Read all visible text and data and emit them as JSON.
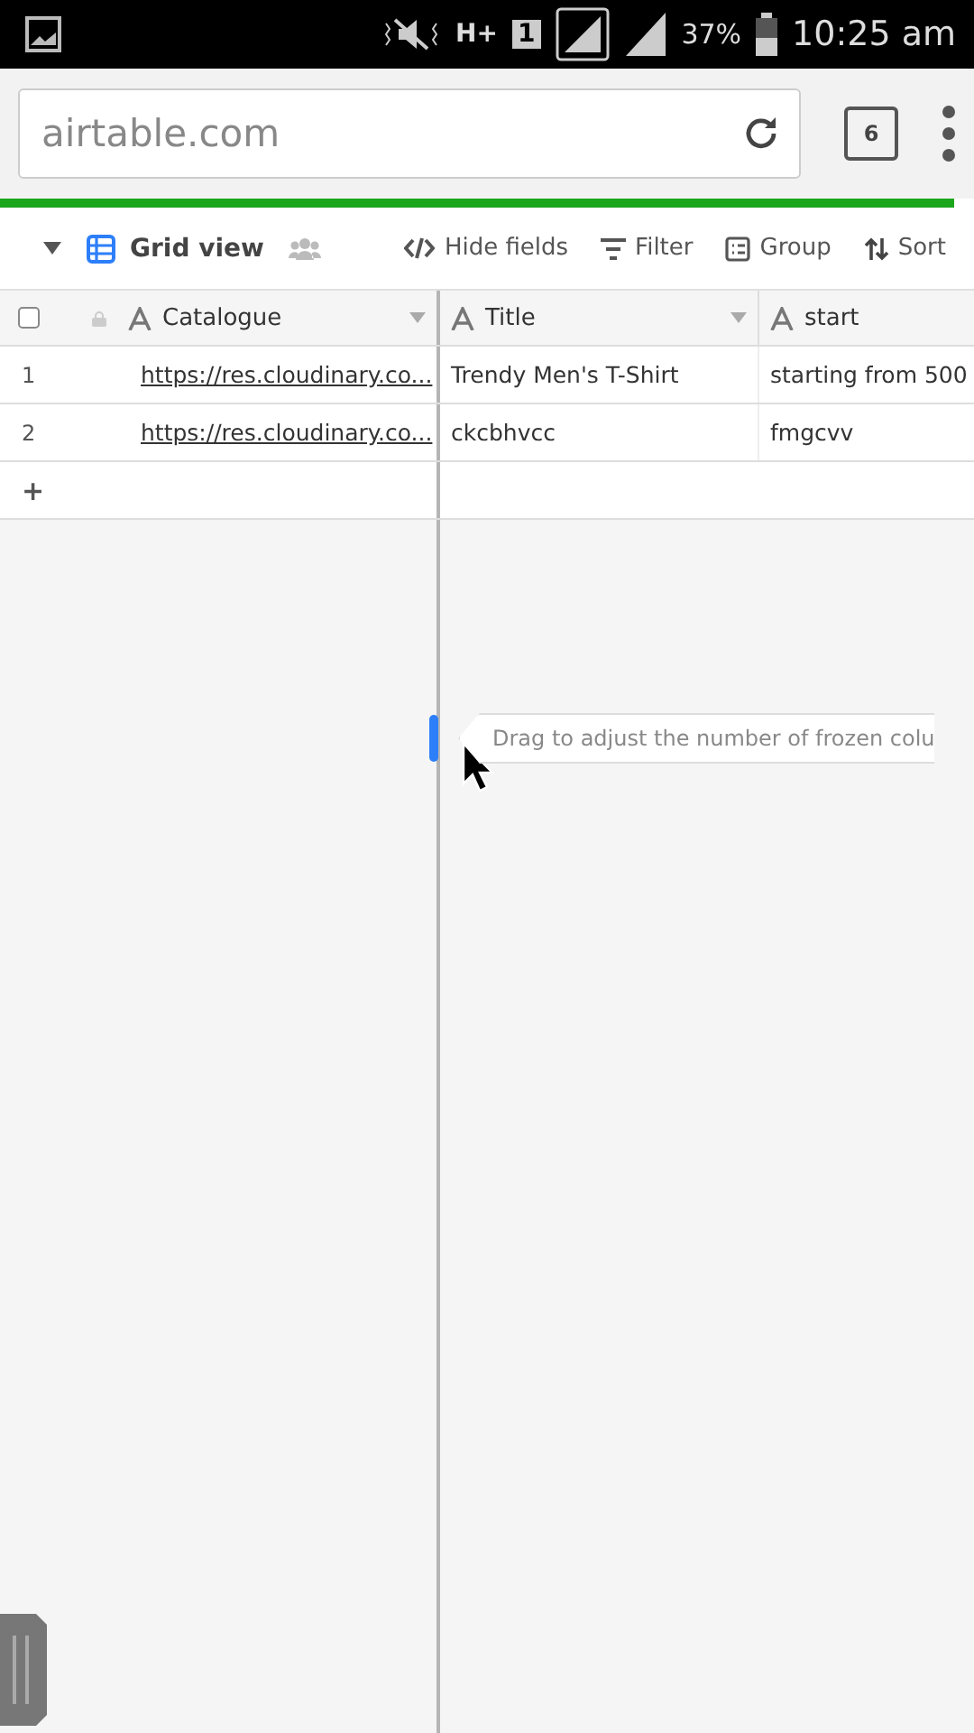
{
  "status_bar": {
    "network": "H+",
    "sim": "1",
    "battery": "37%",
    "time": "10:25 am"
  },
  "browser": {
    "url": "airtable.com",
    "tab_count": "6",
    "level": 0.98
  },
  "toolbar": {
    "view": "Grid view",
    "actions": [
      {
        "kind": "hide",
        "label": "Hide fields"
      },
      {
        "kind": "filter",
        "label": "Filter"
      },
      {
        "kind": "group",
        "label": "Group"
      },
      {
        "kind": "sort",
        "label": "Sort"
      }
    ]
  },
  "table": {
    "select_all": {
      "checked": false
    },
    "columns": [
      {
        "label": "Catalogue",
        "menu": true
      },
      {
        "label": "Title",
        "menu": true
      },
      {
        "label": "start",
        "menu": false
      }
    ],
    "rows": [
      {
        "number": "1",
        "cells": [
          "https://res.cloudinary.co...",
          "Trendy Men's T-Shirt",
          "starting from 500"
        ]
      },
      {
        "number": "2",
        "cells": [
          "https://res.cloudinary.co...",
          "ckcbhvcc",
          "fmgcvv"
        ]
      }
    ],
    "add_row": "+"
  },
  "tooltip": "Drag to adjust the number of frozen colu"
}
